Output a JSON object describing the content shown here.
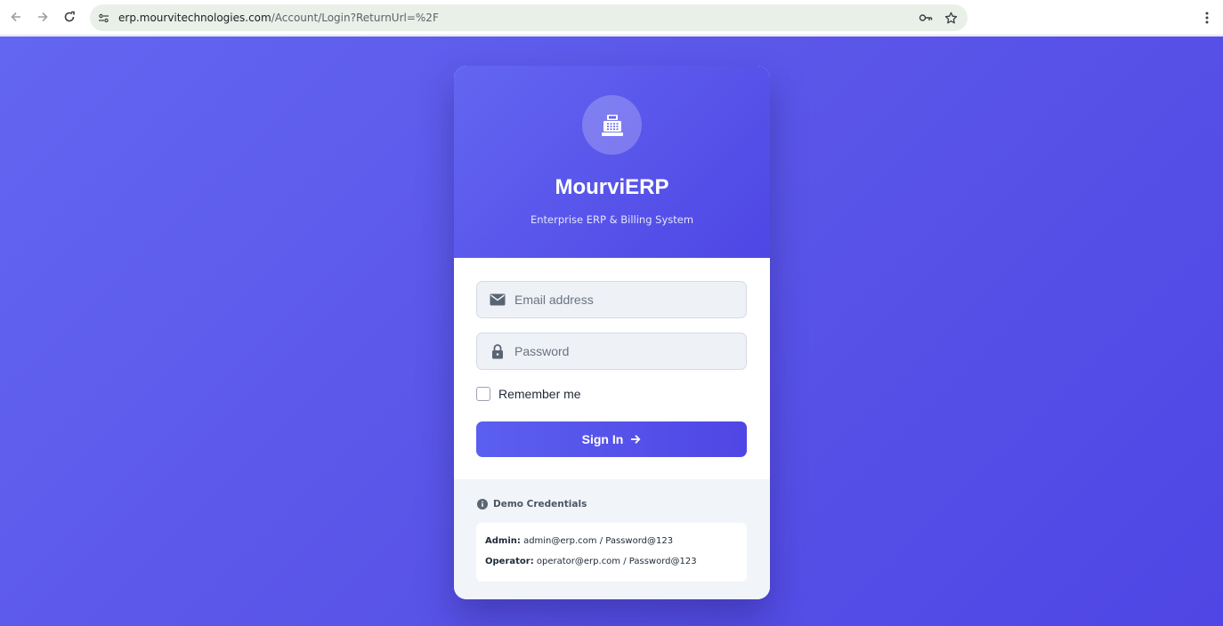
{
  "browser": {
    "url_host": "erp.mourvitechnologies.com",
    "url_path": "/Account/Login?ReturnUrl=%2F"
  },
  "brand": {
    "name": "MourviERP",
    "tagline": "Enterprise ERP & Billing System",
    "logo_icon": "cash-register-icon"
  },
  "form": {
    "email_placeholder": "Email address",
    "email_value": "",
    "password_placeholder": "Password",
    "password_value": "",
    "remember_label": "Remember me",
    "remember_checked": false,
    "signin_label": "Sign In"
  },
  "demo": {
    "title": "Demo Credentials",
    "credentials": [
      {
        "role": "Admin:",
        "value": "admin@erp.com / Password@123"
      },
      {
        "role": "Operator:",
        "value": "operator@erp.com / Password@123"
      }
    ]
  },
  "colors": {
    "background": "#5a55e8",
    "accent": "#4f46e5"
  }
}
